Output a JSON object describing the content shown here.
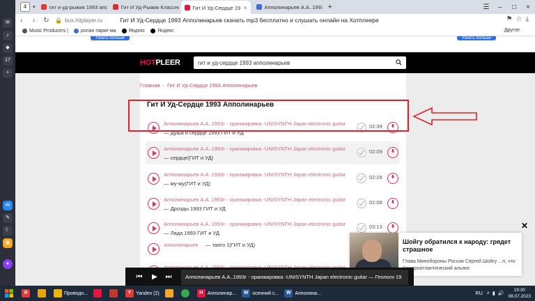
{
  "browser": {
    "tab_count": "4",
    "tabs": [
      {
        "label": "гит и уд-рыжик 1993 апо",
        "color": "#e53935"
      },
      {
        "label": "Гит И Уд-Рыжик Классно",
        "color": "#d32f2f"
      },
      {
        "label": "Гит И Уд-Сердце 1993 А",
        "color": "#e8163f",
        "active": true
      },
      {
        "label": "Апполинарьев А.А..1993г",
        "color": "#3f6fd6"
      }
    ],
    "url": "box.hitplayer.ru",
    "page_title": "Гит И Уд-Сердце 1993 Апполинарьев скачать mp3 бесплатно и слушать онлайн на Хотплеере",
    "bookmarks": [
      {
        "label": "Music Producers | ",
        "color": "#555"
      },
      {
        "label": "ролан парке ма",
        "color": "#3f6fd6"
      },
      {
        "label": "Яндекс",
        "color": "#000"
      },
      {
        "label": "Яндекс",
        "color": "#000"
      }
    ],
    "bookmarks_other": "Другое"
  },
  "site": {
    "top_button": "Узнать больше",
    "logo_hot": "HOT",
    "logo_pleer": "PLEER",
    "search_value": "гит и уд-сердце 1993 апполинарьев",
    "breadcrumb": {
      "home": "Главная",
      "current": "Гит И Уд-Сердце 1993 Апполинарьев"
    },
    "heading": "Гит И Уд-Сердце 1993 Апполинарьев",
    "tracks": [
      {
        "artist": "Апполинарьев А.А..1993г - оранжировка -UNISYNTH Japan electronic guitar",
        "song": "— Душа и сердце 1993 ГИТ и УД",
        "duration": "02:39"
      },
      {
        "artist": "Апполинарьев А.А..1993г - оранжировка -UNISYNTH Japan electronic guitar",
        "song": "— сердце(ГИТ и УД)",
        "duration": "02:09"
      },
      {
        "artist": "Апполинарьев А.А..1993г - оранжировка -UNISYNTH Japan electronic guitar",
        "song": "— му-му(ГИТ и УД)",
        "duration": "02:28"
      },
      {
        "artist": "Апполинарьев А.А..1993г - оранжировка -UNISYNTH Japan electronic guitar",
        "song": "— Дрозды 1993 ГИТ и УД",
        "duration": "02:08"
      },
      {
        "artist": "Апполинарьев А.А..1993г - оранжировка -UNISYNTH Japan electronic guitar",
        "song": "— Лада 1993 ГИТ и УД",
        "duration": "03:13"
      },
      {
        "artist": "апполинарьев",
        "song": "— танго 1(ГИТ и УД)",
        "duration": ""
      },
      {
        "artist": "Апполинарьев А.А..1993г - оранжировка -UNISYNTH Japan electronic guitar",
        "song": "",
        "duration": ""
      }
    ],
    "player_track": "Апполинарьев А.А..1993г - оранжировка -UNISYNTH Japan electronic guitar — Геологи 19"
  },
  "news": {
    "title": "Шойгу обратился к народу: грядет страшное",
    "text": "Глава Минобороны России Сергей Шойгу ...л, что Североатлантический альянс"
  },
  "taskbar": {
    "apps": [
      {
        "label": "",
        "color": "#e53935",
        "icon": "Я"
      },
      {
        "label": "",
        "color": "#e8a317",
        "icon": ""
      },
      {
        "label": "Проводн...",
        "color": "#f0b400",
        "icon": ""
      },
      {
        "label": "",
        "color": "#e8163f",
        "icon": ""
      },
      {
        "label": "",
        "color": "#c0392b",
        "icon": ""
      },
      {
        "label": "Yandex (2)",
        "color": "#e53935",
        "icon": "Y"
      },
      {
        "label": "",
        "color": "#f5a623",
        "icon": ""
      },
      {
        "label": "",
        "color": "#34a853",
        "icon": ""
      },
      {
        "label": "Апполинар...",
        "color": "#e8163f",
        "icon": "H"
      },
      {
        "label": "осенний с...",
        "color": "#2b5797",
        "icon": "W"
      },
      {
        "label": "Апполина...",
        "color": "#2b5797",
        "icon": "W"
      }
    ],
    "lang": "RU",
    "time": "19:30",
    "date": "08.07.2023"
  }
}
